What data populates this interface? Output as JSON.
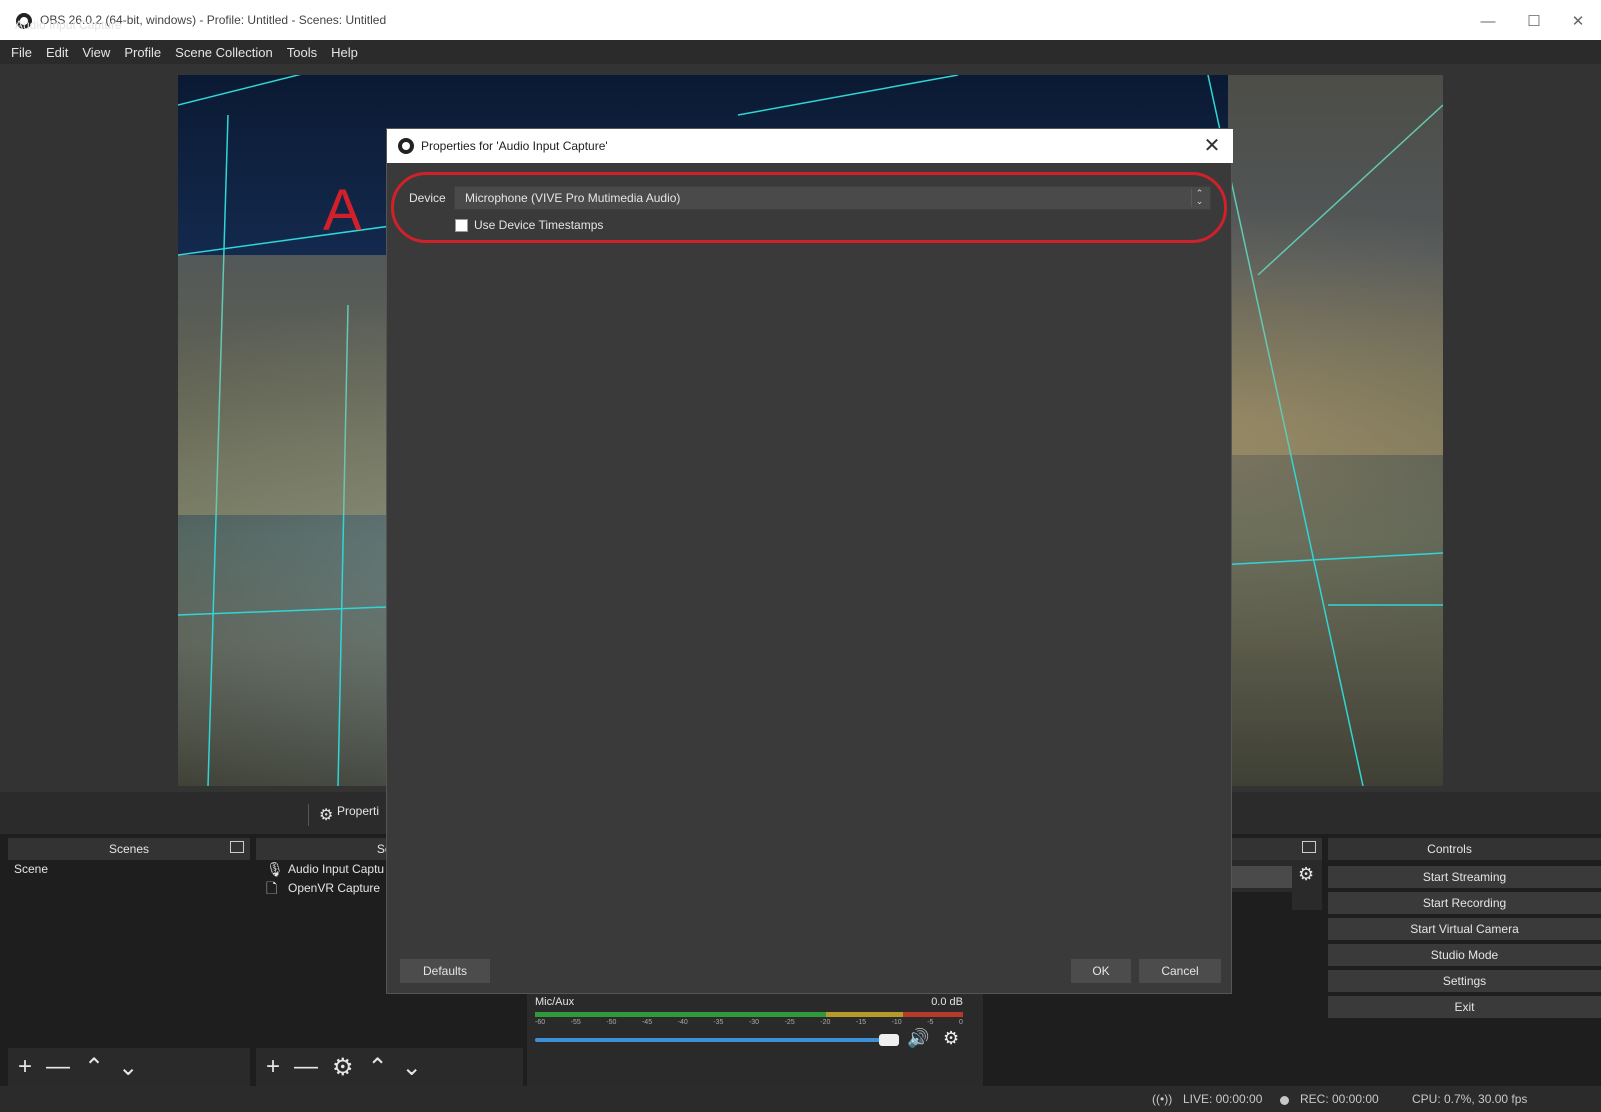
{
  "window": {
    "title": "OBS 26.0.2 (64-bit, windows) - Profile: Untitled - Scenes: Untitled",
    "minimize": "—",
    "maximize": "☐",
    "close": "✕"
  },
  "menu": [
    "File",
    "Edit",
    "View",
    "Profile",
    "Scene Collection",
    "Tools",
    "Help"
  ],
  "source_bar": {
    "selected_source": "Audio Input Capture",
    "properties_label": "Properti"
  },
  "scenes": {
    "header": "Scenes",
    "items": [
      "Scene"
    ],
    "toolbar": [
      "+",
      "—",
      "⌃",
      "⌄"
    ]
  },
  "sources": {
    "header": "Sour",
    "items": [
      {
        "icon": "microphone-icon",
        "glyph": "🎙",
        "label": "Audio Input Captu"
      },
      {
        "icon": "window-icon",
        "glyph": "🗋",
        "label": "OpenVR Capture"
      }
    ],
    "toolbar": [
      "+",
      "—",
      "⚙",
      "⌃",
      "⌄"
    ]
  },
  "controls": {
    "header": "Controls",
    "buttons": [
      "Start Streaming",
      "Start Recording",
      "Start Virtual Camera",
      "Studio Mode",
      "Settings",
      "Exit"
    ]
  },
  "mixer": {
    "channel": "Mic/Aux",
    "level": "0.0 dB",
    "ticks": [
      "-60",
      "-55",
      "-50",
      "-45",
      "-40",
      "-35",
      "-30",
      "-25",
      "-20",
      "-15",
      "-10",
      "-5",
      "0"
    ],
    "volume_fraction": 1.0
  },
  "status": {
    "live": "LIVE: 00:00:00",
    "rec": "REC: 00:00:00",
    "cpu": "CPU: 0.7%, 30.00 fps"
  },
  "dialog": {
    "title": "Properties for 'Audio Input Capture'",
    "close": "✕",
    "device_label": "Device",
    "device_value": "Microphone (VIVE Pro Mutimedia Audio)",
    "timestamps_label": "Use Device Timestamps",
    "timestamps_checked": false,
    "annotation": "A",
    "defaults": "Defaults",
    "ok": "OK",
    "cancel": "Cancel"
  },
  "colors": {
    "annotation": "#d0212b",
    "guide_lines": "#2fd6d6",
    "volume_slider": "#3d8fd6"
  }
}
